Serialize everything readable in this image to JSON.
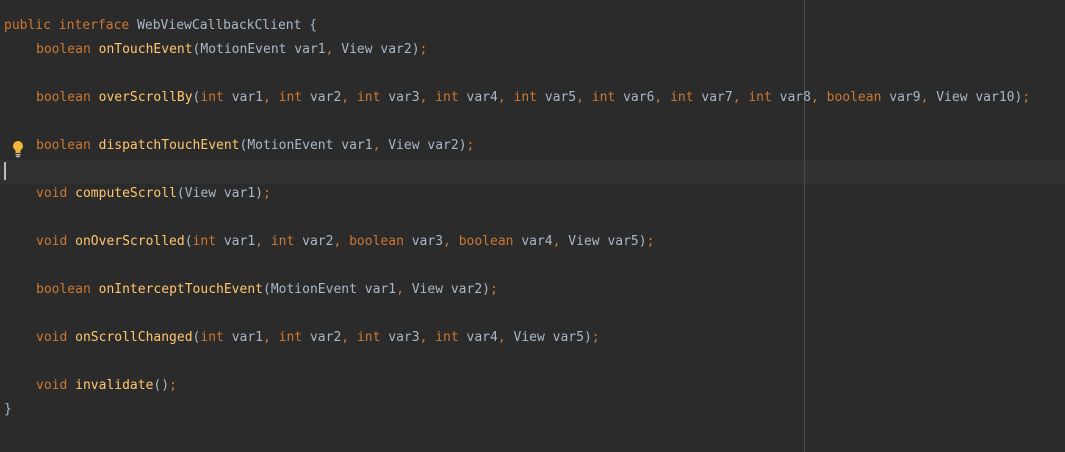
{
  "code": {
    "header": {
      "modifier": "public",
      "keyword": "interface",
      "name": "WebViewCallbackClient",
      "open": "{"
    },
    "close": "}",
    "methods": [
      {
        "ret": "boolean",
        "name": "onTouchEvent",
        "params": [
          {
            "type": "MotionEvent",
            "name": "var1"
          },
          {
            "type": "View",
            "name": "var2"
          }
        ]
      },
      {
        "ret": "boolean",
        "name": "overScrollBy",
        "params": [
          {
            "type": "int",
            "name": "var1"
          },
          {
            "type": "int",
            "name": "var2"
          },
          {
            "type": "int",
            "name": "var3"
          },
          {
            "type": "int",
            "name": "var4"
          },
          {
            "type": "int",
            "name": "var5"
          },
          {
            "type": "int",
            "name": "var6"
          },
          {
            "type": "int",
            "name": "var7"
          },
          {
            "type": "int",
            "name": "var8"
          },
          {
            "type": "boolean",
            "name": "var9"
          },
          {
            "type": "View",
            "name": "var10"
          }
        ]
      },
      {
        "ret": "boolean",
        "name": "dispatchTouchEvent",
        "params": [
          {
            "type": "MotionEvent",
            "name": "var1"
          },
          {
            "type": "View",
            "name": "var2"
          }
        ]
      },
      {
        "ret": "void",
        "name": "computeScroll",
        "params": [
          {
            "type": "View",
            "name": "var1"
          }
        ]
      },
      {
        "ret": "void",
        "name": "onOverScrolled",
        "params": [
          {
            "type": "int",
            "name": "var1"
          },
          {
            "type": "int",
            "name": "var2"
          },
          {
            "type": "boolean",
            "name": "var3"
          },
          {
            "type": "boolean",
            "name": "var4"
          },
          {
            "type": "View",
            "name": "var5"
          }
        ]
      },
      {
        "ret": "boolean",
        "name": "onInterceptTouchEvent",
        "params": [
          {
            "type": "MotionEvent",
            "name": "var1"
          },
          {
            "type": "View",
            "name": "var2"
          }
        ]
      },
      {
        "ret": "void",
        "name": "onScrollChanged",
        "params": [
          {
            "type": "int",
            "name": "var1"
          },
          {
            "type": "int",
            "name": "var2"
          },
          {
            "type": "int",
            "name": "var3"
          },
          {
            "type": "int",
            "name": "var4"
          },
          {
            "type": "View",
            "name": "var5"
          }
        ]
      },
      {
        "ret": "void",
        "name": "invalidate",
        "params": []
      }
    ]
  },
  "gutter": {
    "intention_icon": "lightbulb-icon"
  },
  "colors": {
    "background": "#2b2b2b",
    "keyword": "#cc7832",
    "method": "#ffc66d",
    "text": "#a9b7c6",
    "caret_line": "#323232",
    "bulb": "#f0b73b"
  }
}
